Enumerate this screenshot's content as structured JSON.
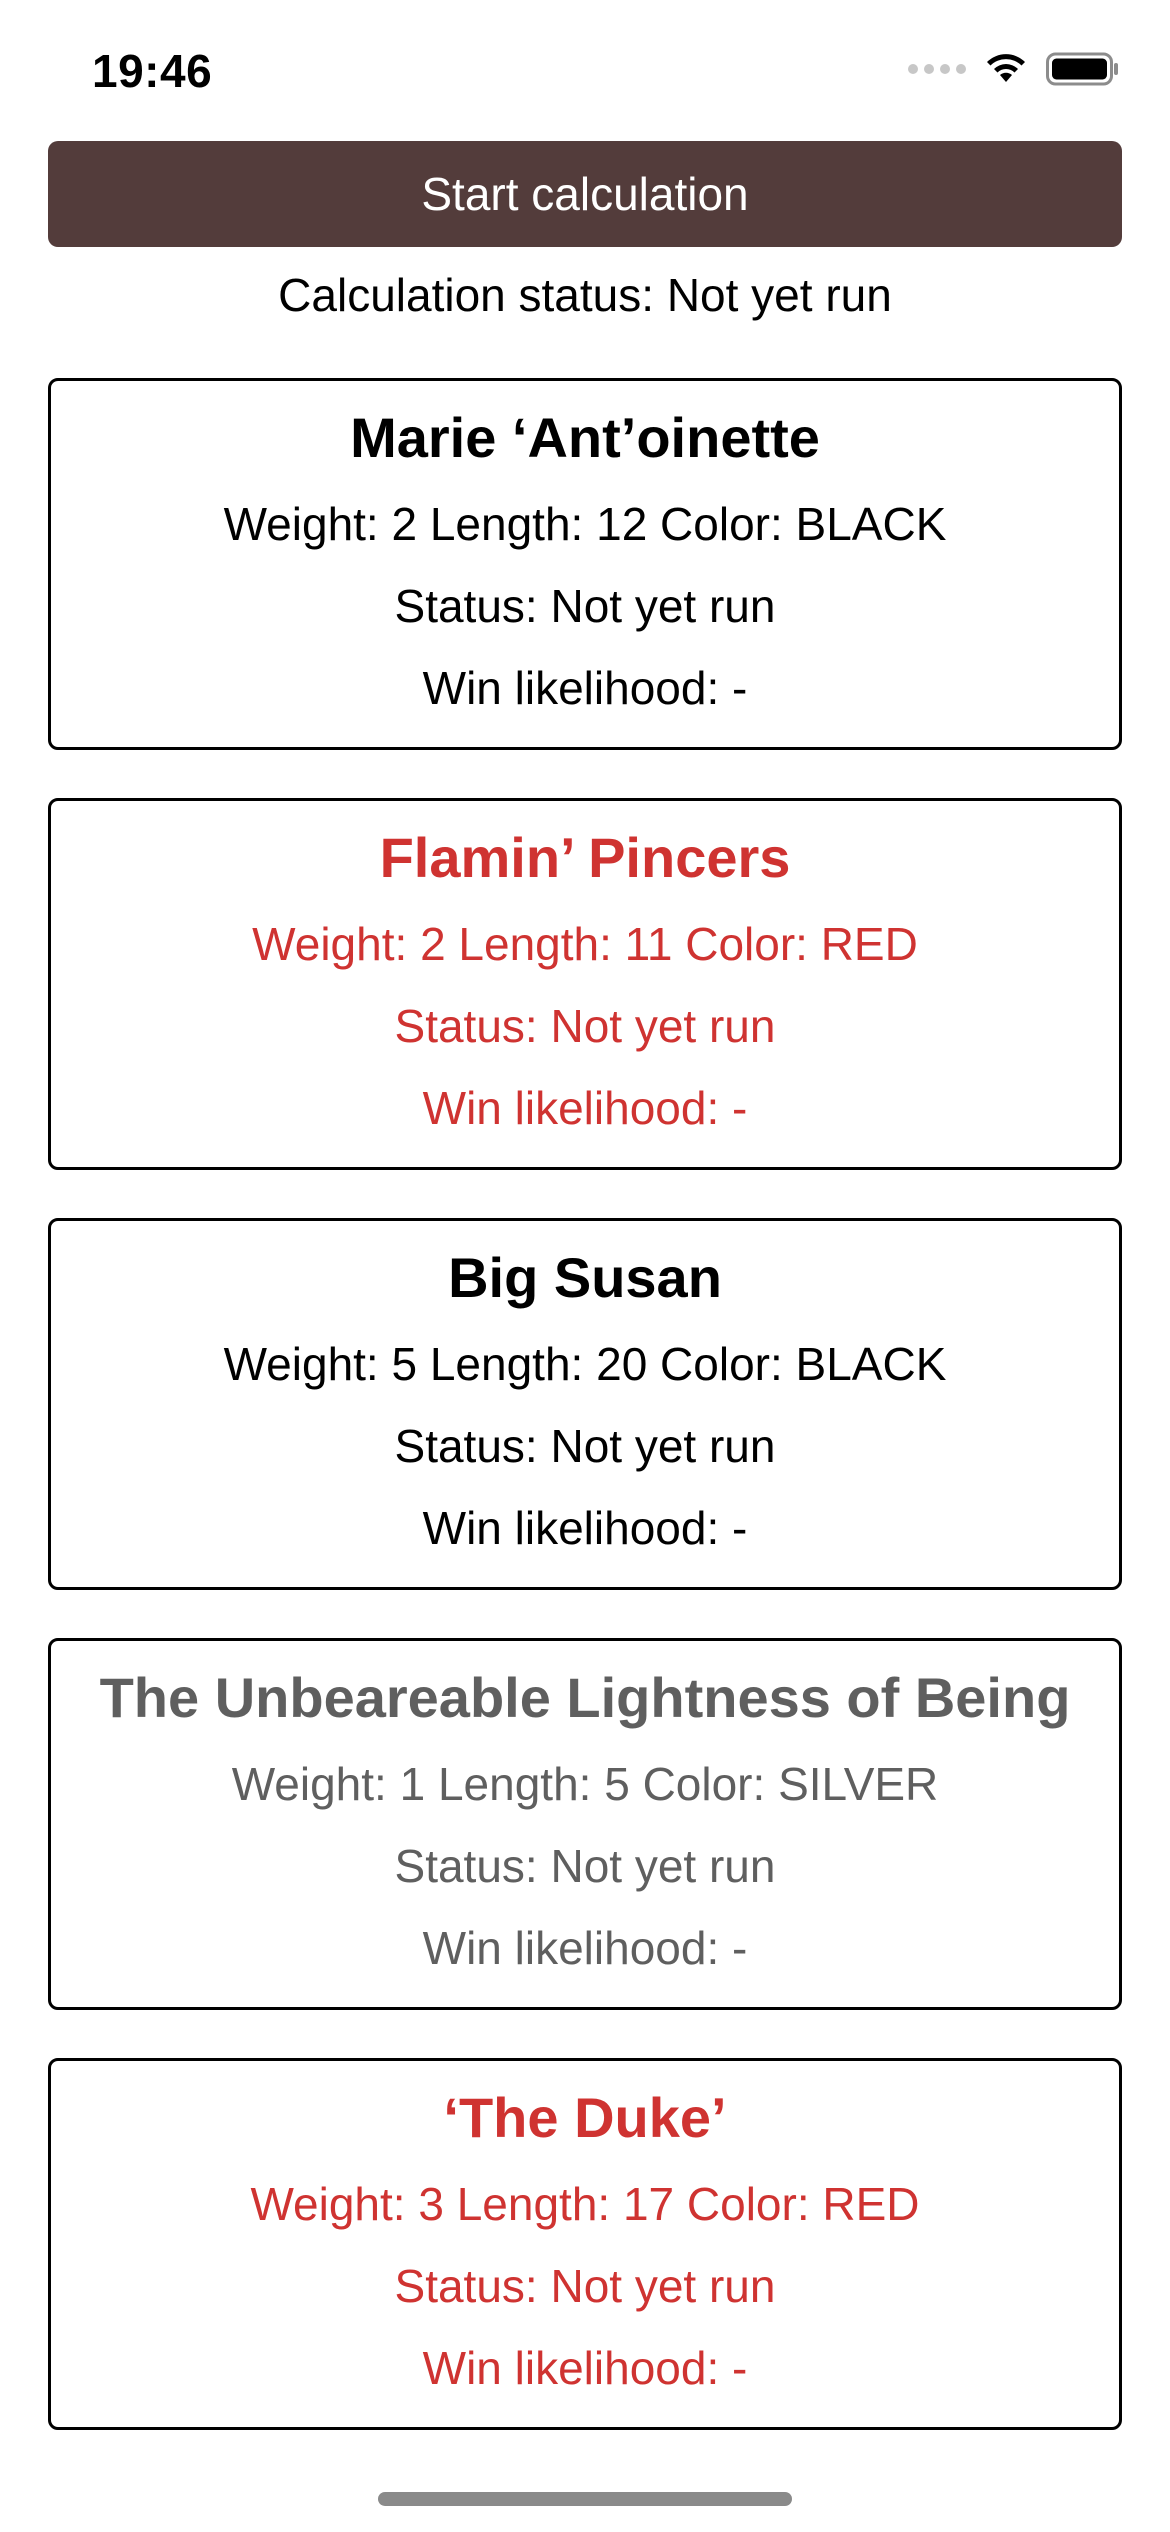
{
  "status_bar": {
    "time": "19:46"
  },
  "controls": {
    "start_label": "Start calculation",
    "calc_status": "Calculation status: Not yet run"
  },
  "cards": [
    {
      "name": "Marie ‘Ant’oinette",
      "stats": "Weight: 2  Length: 12  Color: BLACK",
      "status": "Status: Not yet run",
      "win": "Win likelihood: -",
      "color": "#000000"
    },
    {
      "name": "Flamin’ Pincers",
      "stats": "Weight: 2  Length: 11  Color: RED",
      "status": "Status: Not yet run",
      "win": "Win likelihood: -",
      "color": "#cf3331"
    },
    {
      "name": "Big Susan",
      "stats": "Weight: 5  Length: 20  Color: BLACK",
      "status": "Status: Not yet run",
      "win": "Win likelihood: -",
      "color": "#000000"
    },
    {
      "name": "The Unbeareable Lightness of Being",
      "stats": "Weight: 1  Length: 5  Color: SILVER",
      "status": "Status: Not yet run",
      "win": "Win likelihood: -",
      "color": "#5f5f5f"
    },
    {
      "name": "‘The Duke’",
      "stats": "Weight: 3  Length: 17  Color: RED",
      "status": "Status: Not yet run",
      "win": "Win likelihood: -",
      "color": "#cf3331"
    }
  ],
  "colors": {
    "button_bg": "#533c3b",
    "red": "#cf3331",
    "silver": "#5f5f5f"
  },
  "icons": [
    "cellular-signal-icon",
    "wifi-icon",
    "battery-icon"
  ]
}
